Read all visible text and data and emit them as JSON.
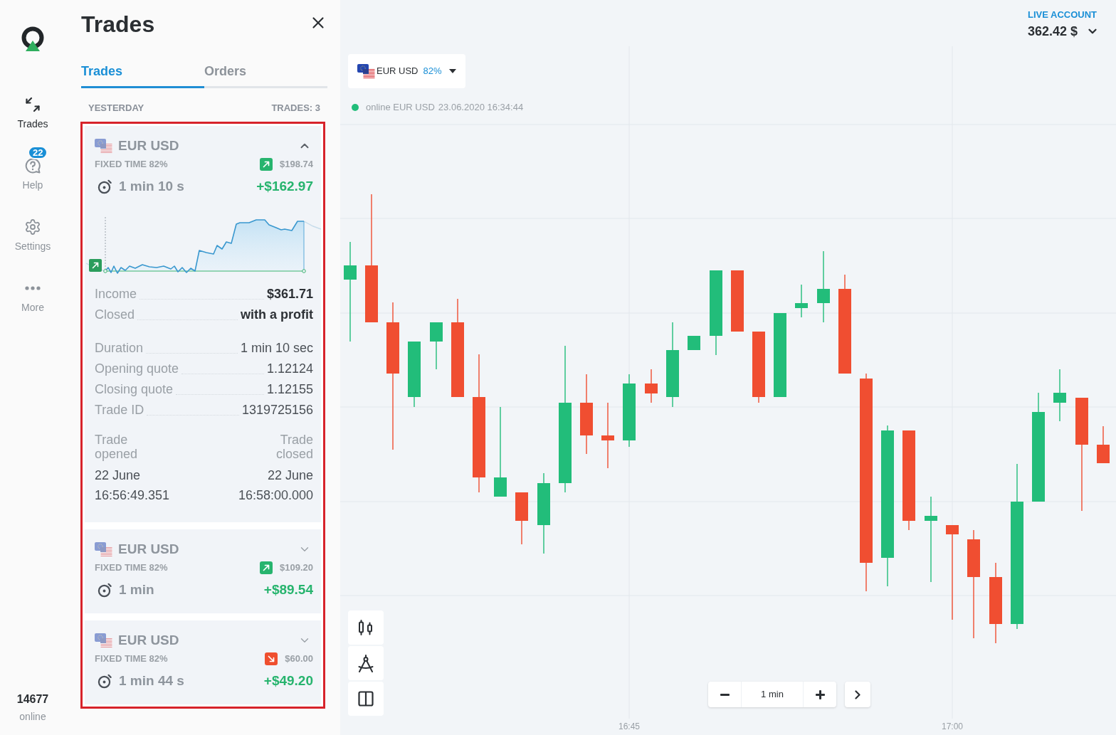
{
  "sidebar": {
    "items": [
      {
        "label": "Trades",
        "selected": true
      },
      {
        "label": "Help",
        "selected": false,
        "badge": "22"
      },
      {
        "label": "Settings",
        "selected": false
      },
      {
        "label": "More",
        "selected": false
      }
    ],
    "online_count": "14677",
    "online_label": "online"
  },
  "panel": {
    "title": "Trades",
    "tabs": [
      {
        "label": "Trades",
        "selected": true
      },
      {
        "label": "Orders",
        "selected": false
      }
    ],
    "group_label": "YESTERDAY",
    "trades_count": "TRADES: 3",
    "trades": [
      {
        "pair": "EUR USD",
        "expanded": true,
        "type": "FIXED TIME 82%",
        "kind": "up",
        "amount": "$198.74",
        "duration": "1 min 10 s",
        "profit": "+$162.97",
        "summary": [
          {
            "label": "Income",
            "value": "$361.71"
          },
          {
            "label": "Closed",
            "value": "with a profit"
          }
        ],
        "info": [
          {
            "label": "Duration",
            "value": "1 min 10 sec"
          },
          {
            "label": "Opening quote",
            "value": "1.12124"
          },
          {
            "label": "Closing quote",
            "value": "1.12155"
          },
          {
            "label": "Trade ID",
            "value": "1319725156"
          }
        ],
        "opened": {
          "label": "Trade opened",
          "date": "22 June",
          "time": "16:56:49.351"
        },
        "closed": {
          "label": "Trade closed",
          "date": "22 June",
          "time": "16:58:00.000"
        }
      },
      {
        "pair": "EUR USD",
        "expanded": false,
        "type": "FIXED TIME 82%",
        "kind": "up",
        "amount": "$109.20",
        "duration": "1 min",
        "profit": "+$89.54"
      },
      {
        "pair": "EUR USD",
        "expanded": false,
        "type": "FIXED TIME 82%",
        "kind": "down",
        "amount": "$60.00",
        "duration": "1 min 44 s",
        "profit": "+$49.20"
      }
    ]
  },
  "chart": {
    "symbol": "EUR USD",
    "payout": "82%",
    "status": "online EUR USD",
    "timestamp": "23.06.2020 16:34:44",
    "timeframe": "1 min",
    "x_labels": [
      "16:45",
      "17:00"
    ]
  },
  "account": {
    "label": "LIVE ACCOUNT",
    "balance": "362.42 $"
  }
}
